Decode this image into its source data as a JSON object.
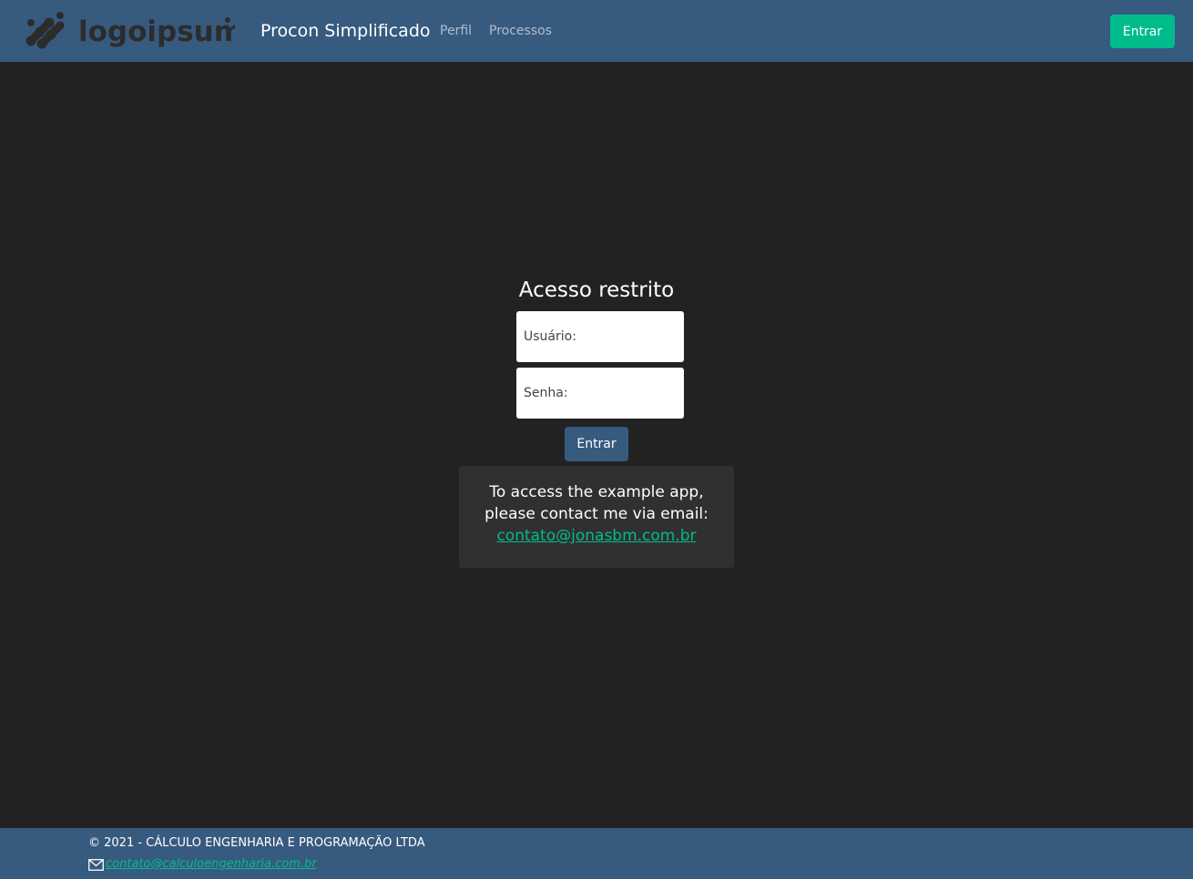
{
  "navbar": {
    "logo_text": "logoipsum",
    "brand": "Procon Simplificado",
    "links": [
      {
        "label": "Perfil"
      },
      {
        "label": "Processos"
      }
    ],
    "login_button": "Entrar"
  },
  "login": {
    "title": "Acesso restrito",
    "username_placeholder": "Usuário:",
    "password_placeholder": "Senha:",
    "submit_label": "Entrar"
  },
  "info": {
    "line1": "To access the example app,",
    "line2": "please contact me via email:",
    "email": "contato@jonasbm.com.br"
  },
  "footer": {
    "copyright": "© 2021 - CÁLCULO ENGENHARIA E PROGRAMAÇÃO LTDA",
    "email": "contato@calculoengenharia.com.br"
  },
  "colors": {
    "background": "#222222",
    "navbar": "#375a7f",
    "accent": "#00bc8c",
    "panel": "#303030",
    "logo": "#2c2c2c"
  },
  "icons": [
    "logo-mark-icon",
    "mail-icon"
  ]
}
